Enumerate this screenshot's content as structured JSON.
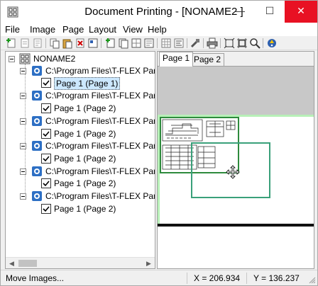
{
  "window": {
    "title": "Document Printing - [NONAME2 ]",
    "minimize_glyph": "—",
    "maximize_glyph": "☐",
    "close_glyph": "✕"
  },
  "menu": [
    "File",
    "Image",
    "Page",
    "Layout",
    "View",
    "Help"
  ],
  "toolbar": {
    "icons": [
      "add-image-icon",
      "remove-image-icon",
      "image-properties-icon",
      "copy-image-icon",
      "paste-image-icon",
      "delete-image-icon",
      "new-page-icon",
      "duplicate-page-icon",
      "page-layout-icon",
      "page-setup-icon",
      "grid-icon",
      "align-icon",
      "tools-icon",
      "print-icon",
      "fit-icon",
      "fit-all-icon",
      "zoom-icon",
      "help-icon"
    ]
  },
  "tree": {
    "root": "NONAME2",
    "documents": [
      {
        "path": "C:\\Program Files\\T-FLEX Parametric",
        "page": "Page 1 (Page 1)",
        "selected": true
      },
      {
        "path": "C:\\Program Files\\T-FLEX Parametric",
        "page": "Page 1 (Page 2)",
        "selected": false
      },
      {
        "path": "C:\\Program Files\\T-FLEX Parametric",
        "page": "Page 1 (Page 2)",
        "selected": false
      },
      {
        "path": "C:\\Program Files\\T-FLEX Parametric",
        "page": "Page 1 (Page 2)",
        "selected": false
      },
      {
        "path": "C:\\Program Files\\T-FLEX Parametric",
        "page": "Page 1 (Page 2)",
        "selected": false
      },
      {
        "path": "C:\\Program Files\\T-FLEX Parametric",
        "page": "Page 1 (Page 2)",
        "selected": false
      }
    ]
  },
  "tabs": [
    "Page 1",
    "Page 2"
  ],
  "active_tab": "Page 1",
  "status": {
    "message": "Move Images...",
    "x": "X = 206.934",
    "y": "Y = 136.237"
  },
  "colors": {
    "close_button": "#e81123",
    "selection": "#cce8ff",
    "page_border": "#b8f0b8",
    "image_frame": "#2e8b3d",
    "moving_frame": "#3aa07a"
  }
}
